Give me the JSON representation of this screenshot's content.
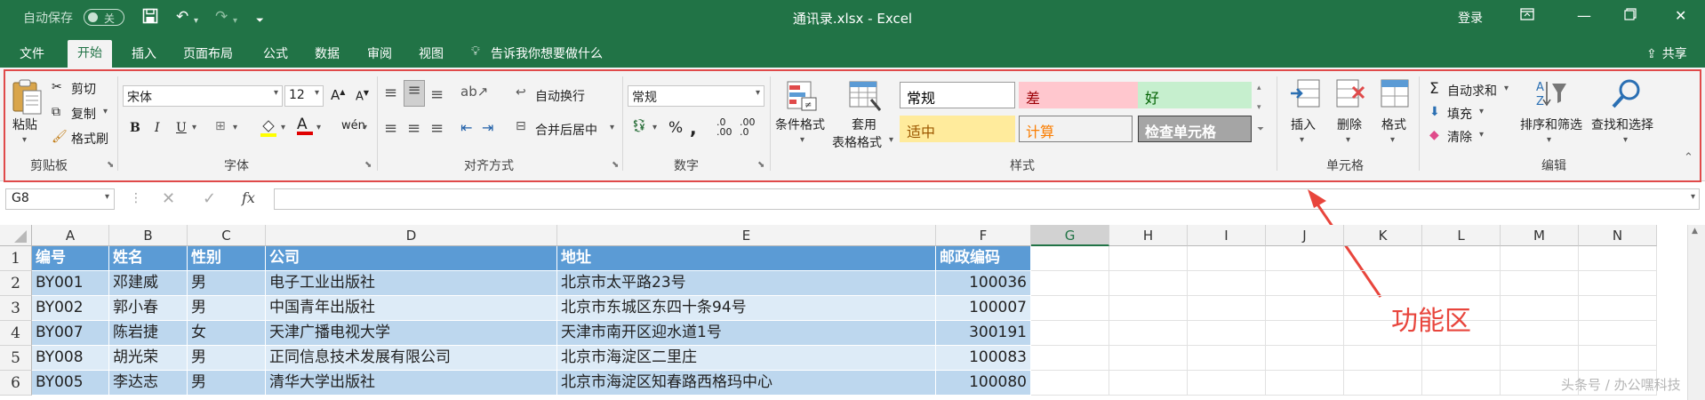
{
  "title_bar": {
    "autosave_label": "自动保存",
    "autosave_state": "关",
    "document_title": "通讯录.xlsx - Excel",
    "login": "登录"
  },
  "tabs": [
    {
      "label": "文件"
    },
    {
      "label": "开始",
      "active": true
    },
    {
      "label": "插入"
    },
    {
      "label": "页面布局"
    },
    {
      "label": "公式"
    },
    {
      "label": "数据"
    },
    {
      "label": "审阅"
    },
    {
      "label": "视图"
    }
  ],
  "tell_me": "告诉我你想要做什么",
  "share": "共享",
  "ribbon": {
    "clipboard": {
      "paste": "粘贴",
      "cut": "剪切",
      "copy": "复制",
      "format_painter": "格式刷",
      "label": "剪贴板"
    },
    "font": {
      "font_name": "宋体",
      "font_size": "12",
      "label": "字体"
    },
    "alignment": {
      "wrap_text": "自动换行",
      "merge_center": "合并后居中",
      "label": "对齐方式"
    },
    "number": {
      "format": "常规",
      "label": "数字"
    },
    "styles": {
      "conditional_format": "条件格式",
      "table_format_line1": "套用",
      "table_format_line2": "表格格式",
      "cells": [
        {
          "text": "常规",
          "bg": "#ffffff",
          "fg": "#000000",
          "border": "#9c9c9c"
        },
        {
          "text": "差",
          "bg": "#ffc7ce",
          "fg": "#9c0006",
          "border": "#ffc7ce"
        },
        {
          "text": "好",
          "bg": "#c6efce",
          "fg": "#006100",
          "border": "#c6efce"
        },
        {
          "text": "适中",
          "bg": "#ffeb9c",
          "fg": "#9c5700",
          "border": "#ffeb9c"
        },
        {
          "text": "计算",
          "bg": "#f2f2f2",
          "fg": "#fa7d00",
          "border": "#7f7f7f"
        },
        {
          "text": "检查单元格",
          "bg": "#a5a5a5",
          "fg": "#ffffff",
          "border": "#3f3f3f"
        }
      ],
      "label": "样式"
    },
    "cells_group": {
      "insert": "插入",
      "delete": "删除",
      "format": "格式",
      "label": "单元格"
    },
    "editing": {
      "autosum": "自动求和",
      "fill": "填充",
      "clear": "清除",
      "sort_filter": "排序和筛选",
      "find_select": "查找和选择",
      "label": "编辑"
    }
  },
  "formula_bar": {
    "name_box": "G8",
    "fx": "fx",
    "value": ""
  },
  "columns": [
    "A",
    "B",
    "C",
    "D",
    "E",
    "F",
    "G",
    "H",
    "I",
    "J",
    "K",
    "L",
    "M",
    "N"
  ],
  "rows": [
    "1",
    "2",
    "3",
    "4",
    "5",
    "6"
  ],
  "table": {
    "headers": [
      "编号",
      "姓名",
      "性别",
      "公司",
      "地址",
      "邮政编码"
    ],
    "rows": [
      [
        "BY001",
        "邓建威",
        "男",
        "电子工业出版社",
        "北京市太平路23号",
        "100036"
      ],
      [
        "BY002",
        "郭小春",
        "男",
        "中国青年出版社",
        "北京市东城区东四十条94号",
        "100007"
      ],
      [
        "BY007",
        "陈岩捷",
        "女",
        "天津广播电视大学",
        "天津市南开区迎水道1号",
        "300191"
      ],
      [
        "BY008",
        "胡光荣",
        "男",
        "正同信息技术发展有限公司",
        "北京市海淀区二里庄",
        "100083"
      ],
      [
        "BY005",
        "李达志",
        "男",
        "清华大学出版社",
        "北京市海淀区知春路西格玛中心",
        "100080"
      ]
    ]
  },
  "annotation": {
    "text": "功能区",
    "color": "#e8453c"
  },
  "watermark": "头条号 / 办公嘿科技",
  "colors": {
    "excel_green": "#217346",
    "header_blue": "#5b9bd5",
    "band_dark": "#bdd7ee",
    "band_light": "#ddebf7",
    "annotation_red": "#e04a4a"
  }
}
